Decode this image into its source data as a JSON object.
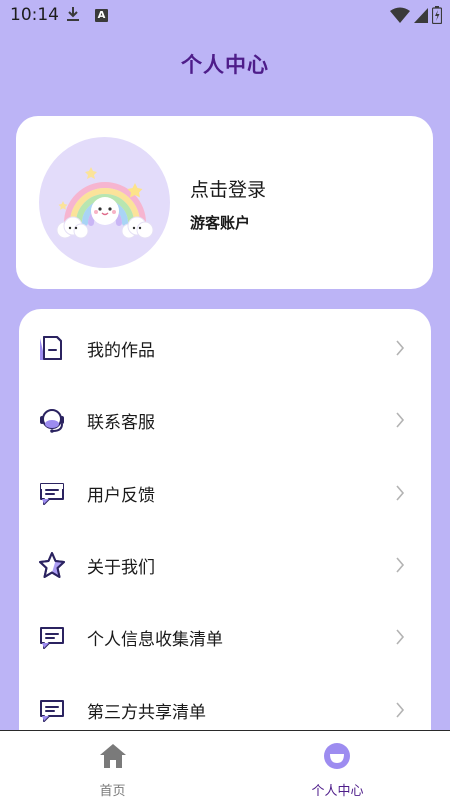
{
  "status_bar": {
    "time": "10:14",
    "notification_icons": [
      "download-icon",
      "a-app-icon"
    ],
    "system_icons": [
      "wifi-icon",
      "signal-icon",
      "battery-icon"
    ]
  },
  "header": {
    "title": "个人中心"
  },
  "profile": {
    "login_label": "点击登录",
    "account_type": "游客账户",
    "avatar": "rainbow-avatar"
  },
  "menu": {
    "items": [
      {
        "label": "我的作品",
        "icon": "works-icon"
      },
      {
        "label": "联系客服",
        "icon": "headset-icon"
      },
      {
        "label": "用户反馈",
        "icon": "feedback-icon"
      },
      {
        "label": "关于我们",
        "icon": "star-icon"
      },
      {
        "label": "个人信息收集清单",
        "icon": "info-list-icon"
      },
      {
        "label": "第三方共享清单",
        "icon": "share-list-icon"
      }
    ]
  },
  "tabbar": {
    "tabs": [
      {
        "label": "首页",
        "icon": "home-icon",
        "active": false
      },
      {
        "label": "个人中心",
        "icon": "profile-face-icon",
        "active": true
      }
    ]
  },
  "colors": {
    "background": "#bcb4f6",
    "title": "#4e1d8a",
    "accent": "#9d8cf0",
    "icon_stroke": "#2b2360",
    "tab_inactive": "#7a7a7a"
  }
}
